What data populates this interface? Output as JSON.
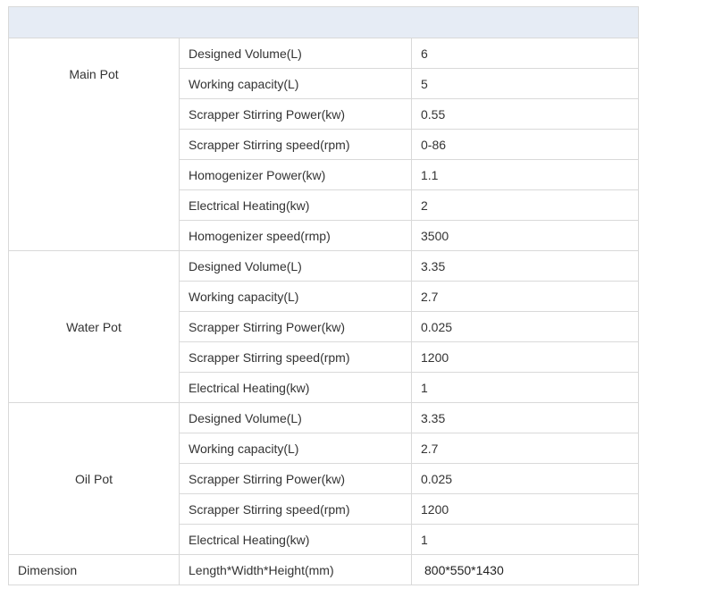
{
  "spec_table": {
    "groups": [
      {
        "name": "Main Pot",
        "rows": [
          {
            "param": "Designed Volume(L)",
            "value": "6"
          },
          {
            "param": "Working capacity(L)",
            "value": "5"
          },
          {
            "param": "Scrapper Stirring Power(kw)",
            "value": "0.55"
          },
          {
            "param": "Scrapper Stirring speed(rpm)",
            "value": "0-86"
          },
          {
            "param": "Homogenizer Power(kw)",
            "value": "1.1"
          },
          {
            "param": "Electrical Heating(kw)",
            "value": "2"
          },
          {
            "param": "Homogenizer speed(rmp)",
            "value": "3500"
          }
        ]
      },
      {
        "name": "Water Pot",
        "rows": [
          {
            "param": "Designed Volume(L)",
            "value": "3.35"
          },
          {
            "param": "Working capacity(L)",
            "value": "2.7"
          },
          {
            "param": "Scrapper Stirring Power(kw)",
            "value": "0.025"
          },
          {
            "param": "Scrapper Stirring speed(rpm)",
            "value": "1200"
          },
          {
            "param": "Electrical Heating(kw)",
            "value": "1"
          }
        ]
      },
      {
        "name": "Oil Pot",
        "rows": [
          {
            "param": "Designed Volume(L)",
            "value": "3.35"
          },
          {
            "param": "Working capacity(L)",
            "value": "2.7"
          },
          {
            "param": "Scrapper Stirring Power(kw)",
            "value": "0.025"
          },
          {
            "param": "Scrapper Stirring speed(rpm)",
            "value": "1200"
          },
          {
            "param": "Electrical Heating(kw)",
            "value": "1"
          }
        ]
      }
    ],
    "dimension": {
      "label": "Dimension",
      "param": "Length*Width*Height(mm)",
      "value": "800*550*1430"
    },
    "colors": {
      "header_background": "#e6ecf5",
      "border": "#d9d9d9",
      "text": "#333333"
    }
  }
}
